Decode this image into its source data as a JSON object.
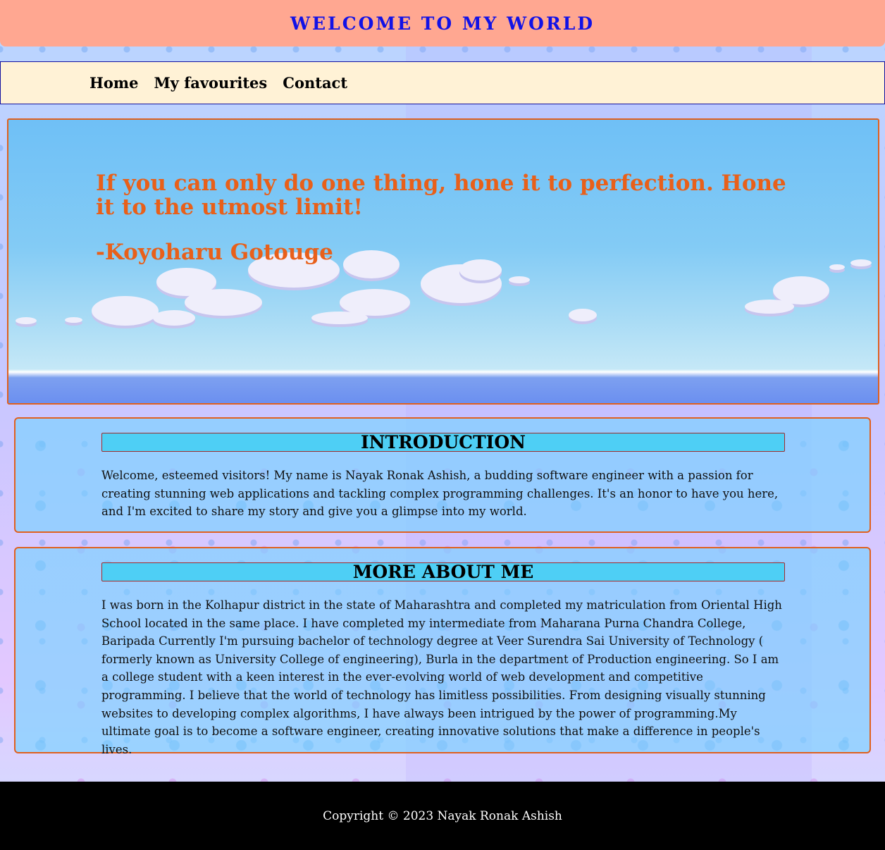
{
  "header": {
    "title": "WELCOME TO MY WORLD"
  },
  "nav": {
    "items": [
      "Home",
      "My favourites",
      "Contact"
    ]
  },
  "hero": {
    "quote": "If you can only do one thing, hone it to perfection. Hone it to the utmost limit!",
    "author": "-Koyoharu Gotouge"
  },
  "introduction": {
    "title": "INTRODUCTION",
    "text": "Welcome, esteemed visitors! My name is Nayak Ronak Ashish, a budding software engineer with a passion for creating stunning web applications and tackling complex programming challenges. It's an honor to have you here, and I'm excited to share my story and give you a glimpse into my world."
  },
  "about": {
    "title": "MORE ABOUT ME",
    "text": "I was born in the Kolhapur district in the state of Maharashtra and completed my matriculation from Oriental High School located in the same place. I have completed my intermediate from Maharana Purna Chandra College, Baripada Currently I'm pursuing bachelor of technology degree at Veer Surendra Sai University of Technology ( formerly known as University College of engineering), Burla in the department of Production engineering. So I am a college student with a keen interest in the ever-evolving world of web development and competitive programming. I believe that the world of technology has limitless possibilities. From designing visually stunning websites to developing complex algorithms, I have always been intrigued by the power of programming.My ultimate goal is to become a software engineer, creating innovative solutions that make a difference in people's lives."
  },
  "footer": {
    "copyright": "Copyright © 2023 Nayak Ronak Ashish"
  },
  "colors": {
    "header_bg": "#ffa791",
    "header_text": "#1212e6",
    "nav_bg": "#fff2d6",
    "accent_orange": "#e8601a",
    "card_title_bg": "#4ecff5",
    "footer_bg": "#000000"
  }
}
